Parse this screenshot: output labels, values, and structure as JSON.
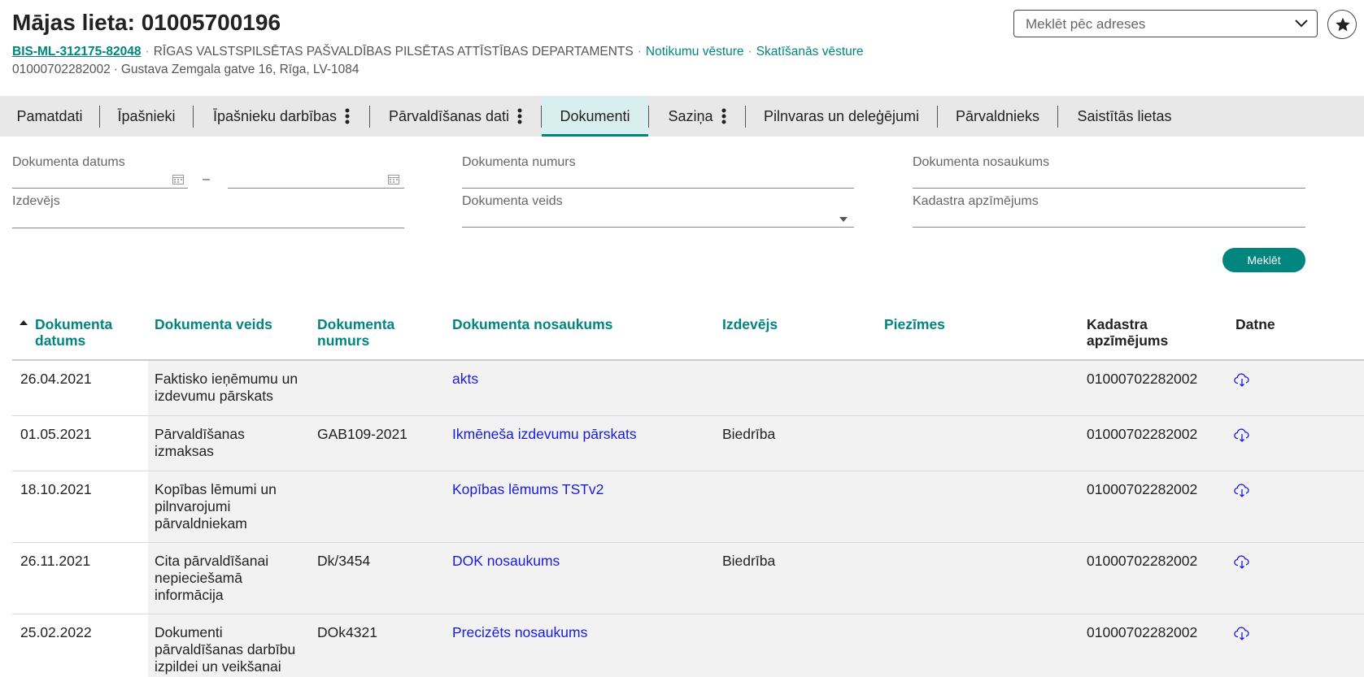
{
  "header": {
    "title": "Mājas lieta: 01005700196",
    "case_code": "BIS-ML-312175-82048",
    "department": "RĪGAS VALSTSPILSĒTAS PAŠVALDĪBAS PILSĒTAS ATTĪSTĪBAS DEPARTAMENTS",
    "link_events": "Notikumu vēsture",
    "link_views": "Skatīšanās vēsture",
    "cadastre": "01000702282002",
    "address": "Gustava Zemgala gatve 16, Rīga, LV-1084",
    "dot": "·"
  },
  "address_search": {
    "placeholder": "Meklēt pēc adreses",
    "icon": "chevron-down-icon"
  },
  "favorite": {
    "icon": "star-icon"
  },
  "tabs": [
    {
      "label": "Pamatdati",
      "has_menu": false,
      "active": false
    },
    {
      "label": "Īpašnieki",
      "has_menu": false,
      "active": false
    },
    {
      "label": "Īpašnieku darbības",
      "has_menu": true,
      "active": false
    },
    {
      "label": "Pārvaldīšanas dati",
      "has_menu": true,
      "active": false
    },
    {
      "label": "Dokumenti",
      "has_menu": false,
      "active": true
    },
    {
      "label": "Saziņa",
      "has_menu": true,
      "active": false
    },
    {
      "label": "Pilnvaras un deleģējumi",
      "has_menu": false,
      "active": false
    },
    {
      "label": "Pārvaldnieks",
      "has_menu": false,
      "active": false
    },
    {
      "label": "Saistītās lietas",
      "has_menu": false,
      "active": false
    }
  ],
  "filters": {
    "doc_date": "Dokumenta datums",
    "date_dash": "–",
    "doc_number": "Dokumenta numurs",
    "doc_name": "Dokumenta nosaukums",
    "issuer": "Izdevējs",
    "doc_type": "Dokumenta veids",
    "cadastre": "Kadastra apzīmējums",
    "search_button": "Meklēt"
  },
  "table": {
    "columns": {
      "date": "Dokumenta datums",
      "type": "Dokumenta veids",
      "number": "Dokumenta numurs",
      "name": "Dokumenta nosaukums",
      "issuer": "Izdevējs",
      "notes": "Piezīmes",
      "cadastre": "Kadastra apzīmējums",
      "file": "Datne"
    },
    "rows": [
      {
        "date": "26.04.2021",
        "type": "Faktisko ieņēmumu un izdevumu pārskats",
        "number": "",
        "name": "akts",
        "issuer": "",
        "notes": "",
        "cadastre": "01000702282002"
      },
      {
        "date": "01.05.2021",
        "type": "Pārvaldīšanas izmaksas",
        "number": "GAB109-2021",
        "name": "Ikmēneša izdevumu pārskats",
        "issuer": "Biedrība",
        "notes": "",
        "cadastre": "01000702282002"
      },
      {
        "date": "18.10.2021",
        "type": "Kopības lēmumi un pilnvarojumi pārvaldniekam",
        "number": "",
        "name": "Kopības lēmums TSTv2",
        "issuer": "",
        "notes": "",
        "cadastre": "01000702282002"
      },
      {
        "date": "26.11.2021",
        "type": "Cita pārvaldīšanai nepieciešamā informācija",
        "number": "Dk/3454",
        "name": "DOK nosaukums",
        "issuer": "Biedrība",
        "notes": "",
        "cadastre": "01000702282002"
      },
      {
        "date": "25.02.2022",
        "type": "Dokumenti pārvaldīšanas darbību izpildei un veikšanai",
        "number": "DOk4321",
        "name": "Precizēts nosaukums",
        "issuer": "",
        "notes": "",
        "cadastre": "01000702282002"
      }
    ]
  },
  "colors": {
    "accent": "#00857f",
    "link": "#1a1adb",
    "tab_bar": "#e8e8e8",
    "active_tab": "#d9efef"
  }
}
